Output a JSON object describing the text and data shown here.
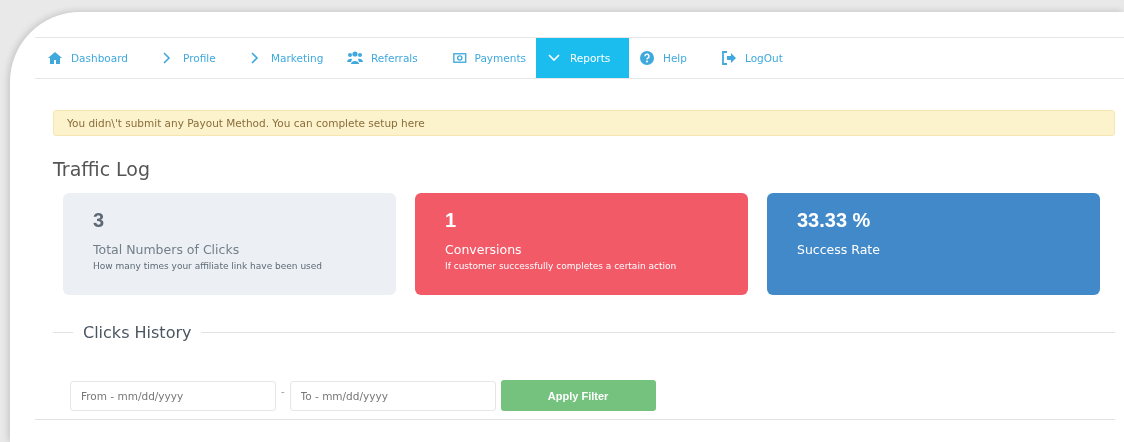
{
  "nav": [
    {
      "label": "Dashboard",
      "selected": false
    },
    {
      "label": "Profile",
      "selected": false
    },
    {
      "label": "Marketing",
      "selected": false
    },
    {
      "label": "Referrals",
      "selected": false
    },
    {
      "label": "Payments",
      "selected": false
    },
    {
      "label": "Reports",
      "selected": true
    },
    {
      "label": "Help",
      "selected": false
    },
    {
      "label": "LogOut",
      "selected": false
    }
  ],
  "alert": "You didn\\'t submit any Payout Method. You can complete setup here",
  "title": "Traffic Log",
  "stats": [
    {
      "value": "3",
      "label": "Total Numbers of Clicks",
      "description": "How many times your affiliate link have been used",
      "color": "#ecf0f4"
    },
    {
      "value": "1",
      "label": "Conversions",
      "description": "If customer successfully completes a certain action",
      "color": "#f25a68"
    },
    {
      "value": "33.33 %",
      "label": "Success Rate",
      "color": "#4189c9"
    }
  ],
  "history": {
    "title": "Clicks History",
    "from": {
      "placeholder": "From - mm/dd/yyyy"
    },
    "separator": "-",
    "to": {
      "placeholder": "To - mm/dd/yyyy"
    },
    "button": "Apply Filter"
  }
}
